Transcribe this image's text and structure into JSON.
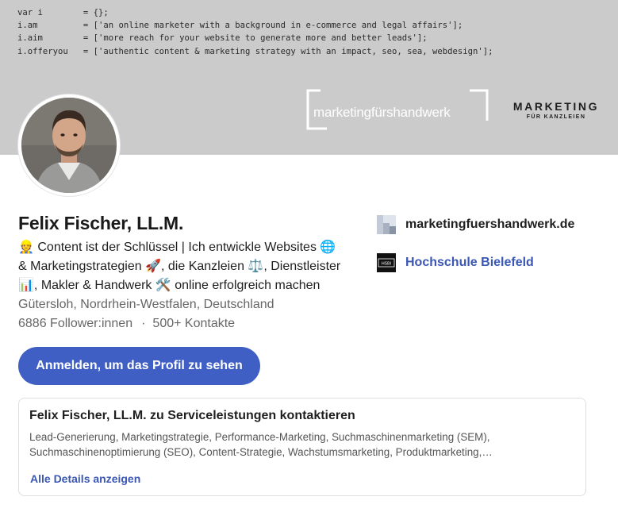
{
  "banner": {
    "code_lines": [
      "var i        = {};",
      "i.am         = ['an online marketer with a background in e-commerce and legal affairs'];",
      "i.aim        = ['more reach for your website to generate more and better leads'];",
      "i.offeryou   = ['authentic content & marketing strategy with an impact, seo, sea, webdesign'];"
    ],
    "logo_handwerk": "marketingfürshandwerk",
    "logo_kanzleien_main": "MARKETING",
    "logo_kanzleien_sub": "FÜR KANZLEIEN"
  },
  "profile": {
    "name": "Felix Fischer, LL.M.",
    "headline_lines": [
      "👷 Content ist der Schlüssel | Ich entwickle Websites 🌐",
      "& Marketingstrategien 🚀, die Kanzleien ⚖️, Dienstleister",
      "📊, Makler & Handwerk 🛠️ online erfolgreich machen"
    ],
    "location": "Gütersloh, Nordrhein-Westfalen, Deutschland",
    "followers": "6886 Follower:innen",
    "separator": "·",
    "connections": "500+ Kontakte",
    "signin_label": "Anmelden, um das Profil zu sehen"
  },
  "sidebar": {
    "company": "marketingfuershandwerk.de",
    "school": "Hochschule Bielefeld",
    "school_logo_text": "HSBI"
  },
  "services": {
    "title": "Felix Fischer, LL.M. zu Serviceleistungen kontaktieren",
    "lines": [
      "Lead-Generierung, Marketingstrategie, Performance-Marketing, Suchmaschinenmarketing (SEM),",
      "Suchmaschinenoptimierung (SEO), Content-Strategie, Wachstumsmarketing, Produktmarketing,…"
    ],
    "link_label": "Alle Details anzeigen"
  },
  "colors": {
    "banner_bg": "#cbcbcb",
    "button_bg": "#3f5fc4",
    "link": "#3a57b4"
  }
}
